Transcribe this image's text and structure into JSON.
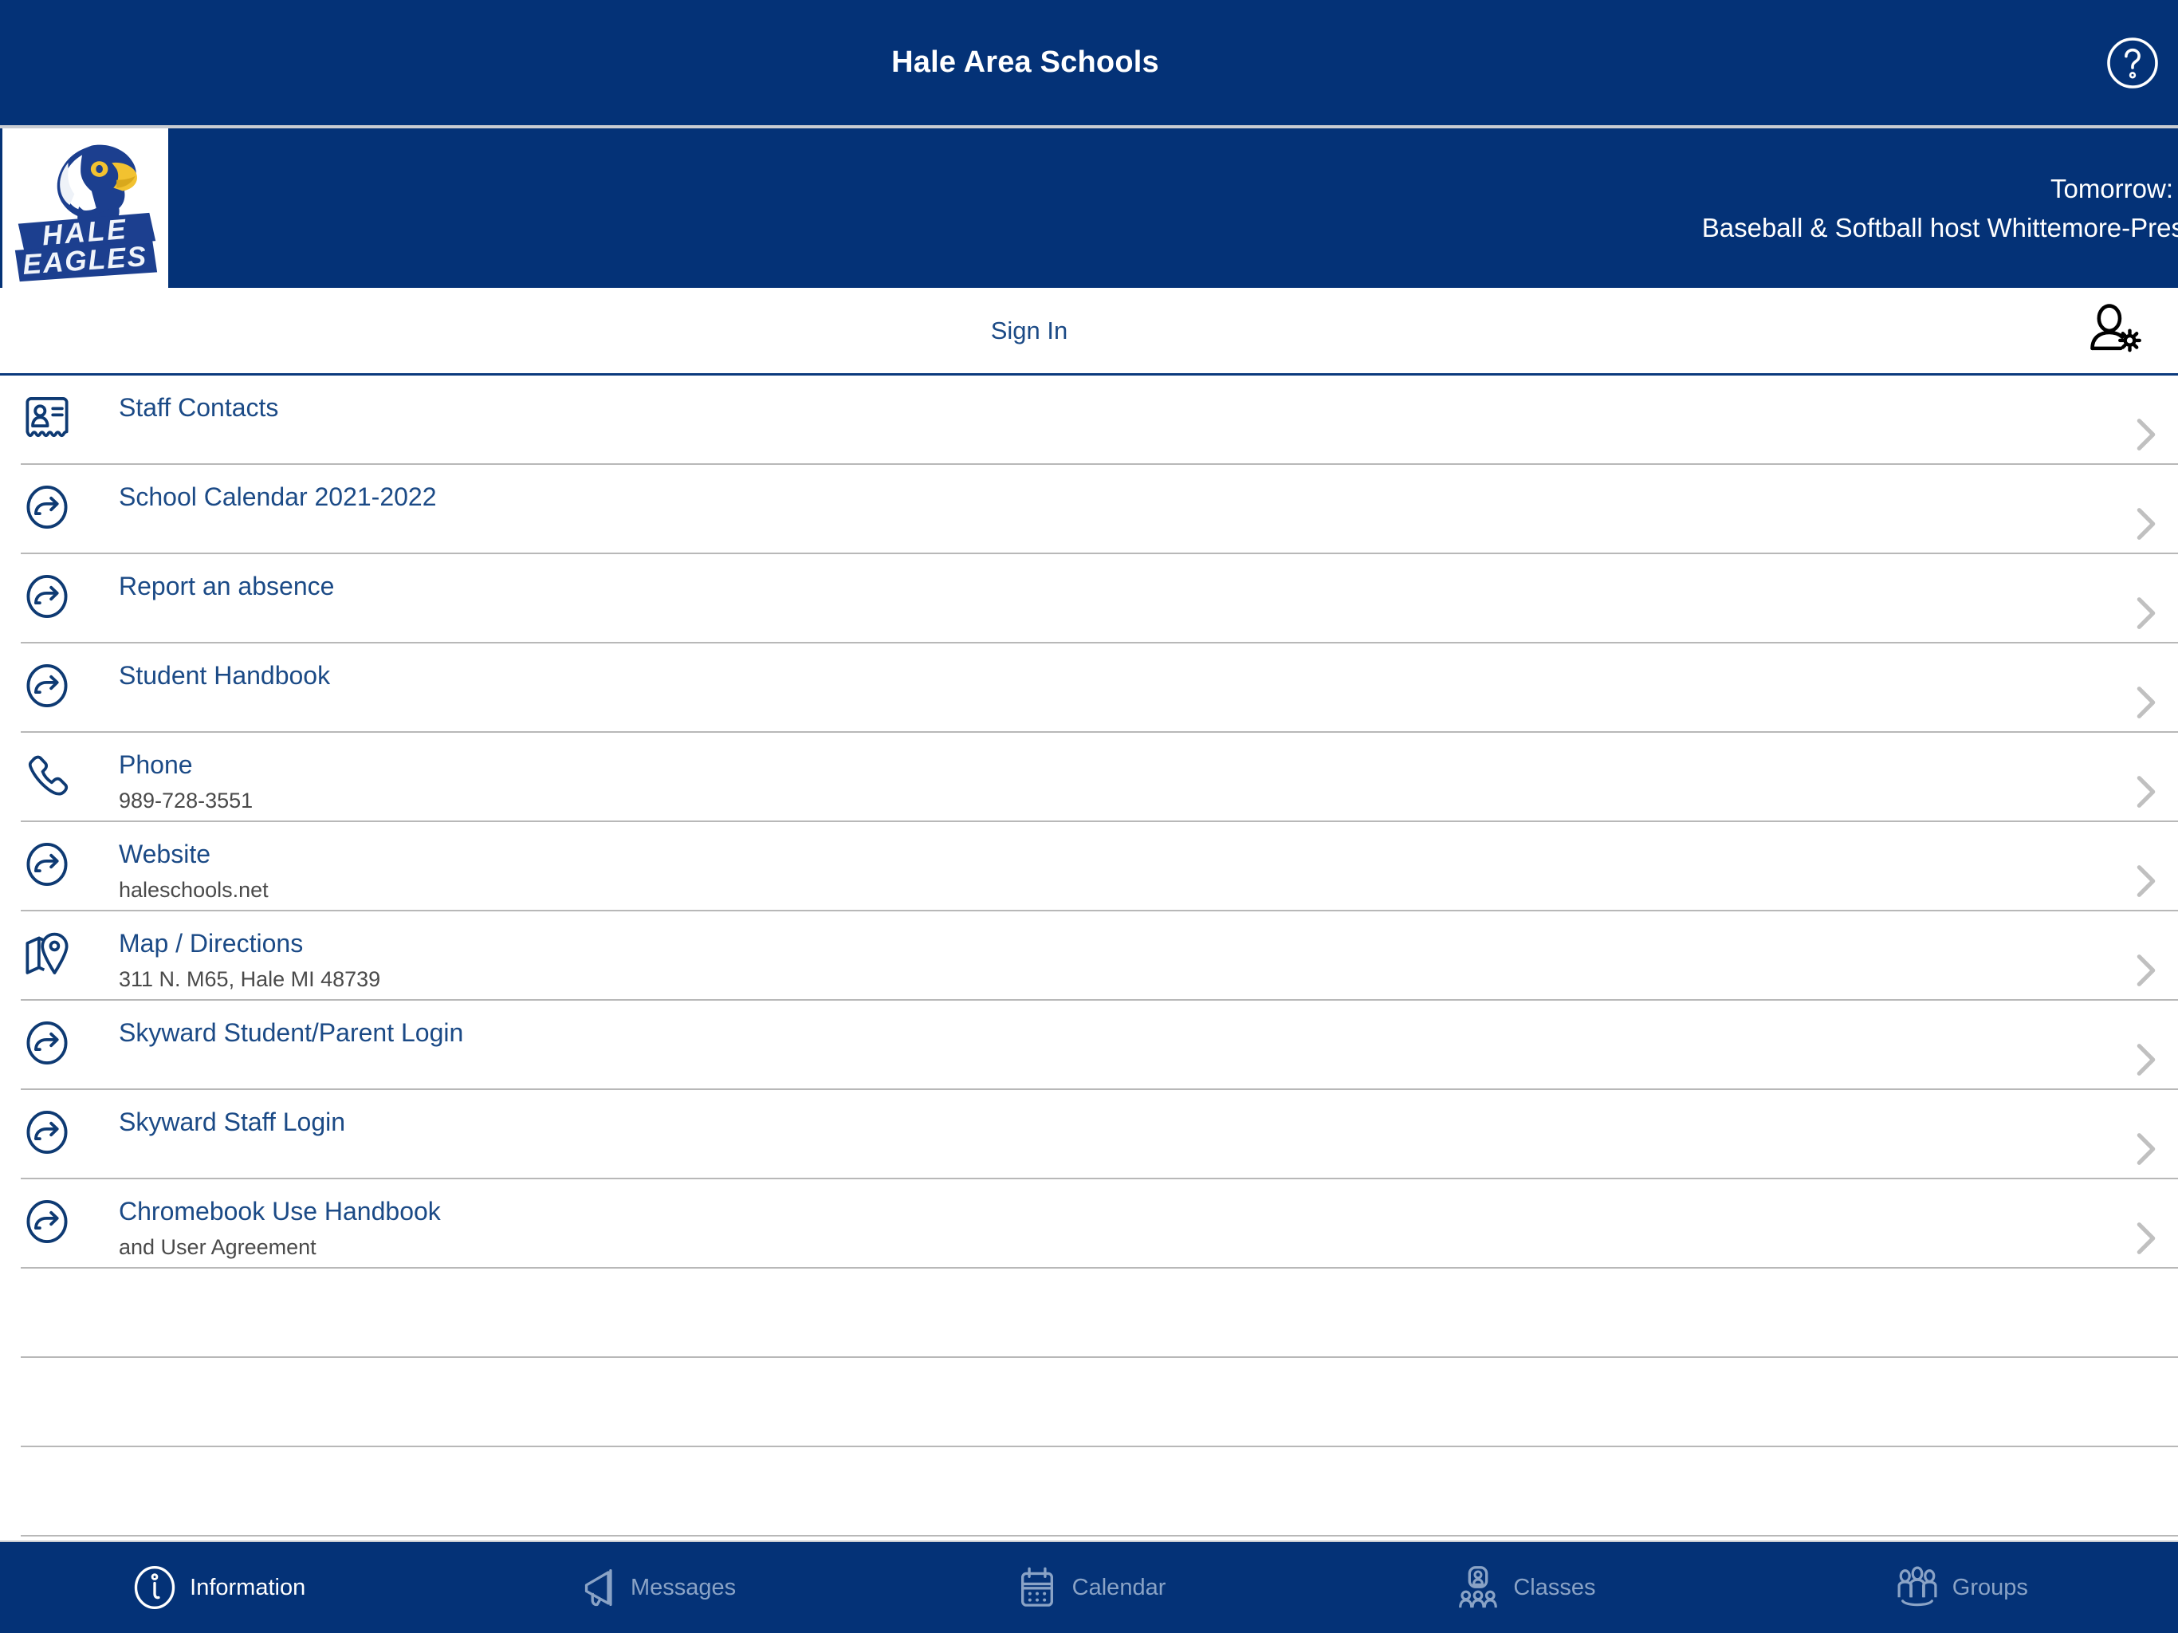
{
  "colors": {
    "brand_blue": "#043277",
    "link_blue": "#1b4a86",
    "separator_gray": "#b8b8b8",
    "inactive_tab": "#8aa3c6",
    "logo_yellow": "#f2c230"
  },
  "navbar": {
    "title": "Hale Area Schools",
    "help_icon": "help-circle-icon"
  },
  "banner": {
    "logo_alt": "HALE EAGLES",
    "logo_line1": "HALE",
    "logo_line2": "EAGLES",
    "ticker_line1": "Tomorrow:",
    "ticker_line2": "Baseball & Softball host Whittemore-Pres"
  },
  "signin": {
    "label": "Sign In",
    "account_icon": "user-gear-icon"
  },
  "list": {
    "items": [
      {
        "title": "Staff Contacts",
        "subtitle": "",
        "icon": "contact-card-icon"
      },
      {
        "title": "School Calendar 2021-2022",
        "subtitle": "",
        "icon": "external-link-icon"
      },
      {
        "title": "Report an absence",
        "subtitle": "",
        "icon": "external-link-icon"
      },
      {
        "title": "Student Handbook",
        "subtitle": "",
        "icon": "external-link-icon"
      },
      {
        "title": "Phone",
        "subtitle": "989-728-3551",
        "icon": "phone-icon"
      },
      {
        "title": "Website",
        "subtitle": "haleschools.net",
        "icon": "external-link-icon"
      },
      {
        "title": "Map / Directions",
        "subtitle": "311 N. M65, Hale MI 48739",
        "icon": "map-pin-icon"
      },
      {
        "title": "Skyward Student/Parent Login",
        "subtitle": "",
        "icon": "external-link-icon"
      },
      {
        "title": "Skyward Staff Login",
        "subtitle": "",
        "icon": "external-link-icon"
      },
      {
        "title": "Chromebook Use Handbook",
        "subtitle": "and User Agreement",
        "icon": "external-link-icon"
      }
    ],
    "empty_rows": 3
  },
  "tabbar": {
    "tabs": [
      {
        "label": "Information",
        "icon": "info-circle-icon",
        "active": true
      },
      {
        "label": "Messages",
        "icon": "megaphone-icon",
        "active": false
      },
      {
        "label": "Calendar",
        "icon": "calendar-icon",
        "active": false
      },
      {
        "label": "Classes",
        "icon": "classes-icon",
        "active": false
      },
      {
        "label": "Groups",
        "icon": "groups-icon",
        "active": false
      }
    ]
  }
}
